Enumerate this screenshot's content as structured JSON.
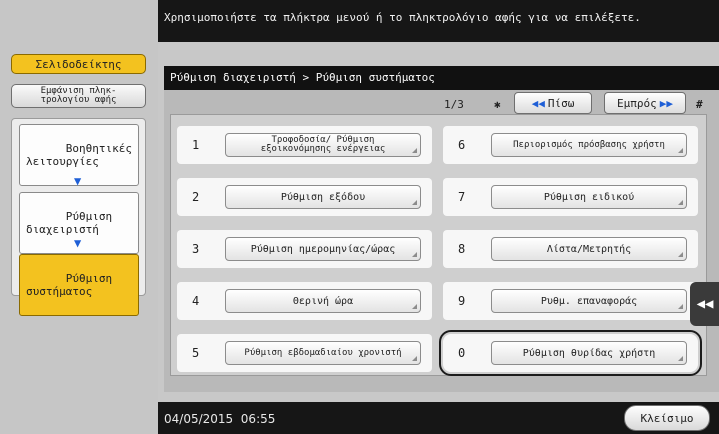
{
  "top_message": "Χρησιμοποιήστε τα πλήκτρα μενού ή το πληκτρολόγιο αφής για να επιλέξετε.",
  "sidebar": {
    "bookmark": "Σελιδοδείκτης",
    "show_keypad": "Εμφάνιση πληκ-\nτρολογίου αφής",
    "flow": [
      {
        "label": "Βοηθητικές\nλειτουργίες"
      },
      {
        "label": "Ρύθμιση\nδιαχειριστή"
      },
      {
        "label": "Ρύθμιση\nσυστήματος"
      }
    ]
  },
  "panel": {
    "breadcrumb": "Ρύθμιση διαχειριστή > Ρύθμιση συστήματος",
    "page_indicator": "1/3",
    "star": "✱",
    "prev_label": "Πίσω",
    "next_label": "Εμπρός",
    "hash": "#"
  },
  "menu_items": [
    {
      "num": "1",
      "label": "Τροφοδοσία/ Ρύθμιση εξοικονόμησης ενέργειας"
    },
    {
      "num": "2",
      "label": "Ρύθμιση εξόδου"
    },
    {
      "num": "3",
      "label": "Ρύθμιση ημερομηνίας/ώρας"
    },
    {
      "num": "4",
      "label": "Θερινή ώρα"
    },
    {
      "num": "5",
      "label": "Ρύθμιση εβδομαδιαίου χρονιστή"
    },
    {
      "num": "6",
      "label": "Περιορισμός πρόσβασης χρήστη"
    },
    {
      "num": "7",
      "label": "Ρύθμιση ειδικού"
    },
    {
      "num": "8",
      "label": "Λίστα/Μετρητής"
    },
    {
      "num": "9",
      "label": "Ρυθμ. επαναφοράς"
    },
    {
      "num": "0",
      "label": "Ρύθμιση θυρίδας χρήστη"
    }
  ],
  "datetime": "04/05/2015  06:55",
  "close_label": "Κλείσιμο",
  "colors": {
    "active": "#f3c21f",
    "bar": "#161616"
  }
}
